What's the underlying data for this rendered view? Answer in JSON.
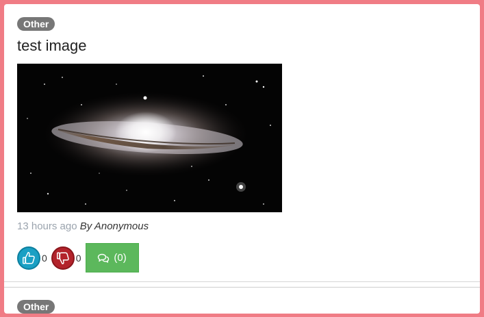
{
  "posts": [
    {
      "category": "Other",
      "title": "test image",
      "image_alt": "galaxy-photo",
      "time_ago": "13 hours ago",
      "author_line": "By Anonymous",
      "likes": "0",
      "dislikes": "0",
      "comments_label": "(0)"
    },
    {
      "category": "Other"
    }
  ],
  "colors": {
    "frame": "#f07c85",
    "badge": "#777777",
    "like": "#1aa0c4",
    "dislike": "#b3232b",
    "comment": "#5cb85c"
  },
  "icons": {
    "like": "thumbs-up-icon",
    "dislike": "thumbs-down-icon",
    "comment": "comments-icon"
  }
}
